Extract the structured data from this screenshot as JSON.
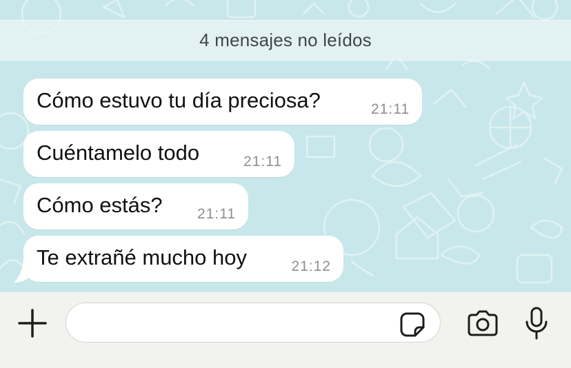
{
  "chat": {
    "unread_banner": "4 mensajes no leídos",
    "messages": [
      {
        "text": "Cómo estuvo tu día preciosa?",
        "time": "21:11"
      },
      {
        "text": "Cuéntamelo todo",
        "time": "21:11"
      },
      {
        "text": "Cómo estás?",
        "time": "21:11"
      },
      {
        "text": "Te extrañé mucho hoy",
        "time": "21:12"
      }
    ]
  },
  "composer": {
    "input_value": "",
    "icons": {
      "add": "plus-icon",
      "sticker": "sticker-icon",
      "camera": "camera-icon",
      "mic": "microphone-icon"
    }
  },
  "colors": {
    "chat_background": "#c8e7ea",
    "bubble": "#ffffff",
    "composer_background": "#f2f2ef",
    "icon": "#1c1c1c"
  }
}
